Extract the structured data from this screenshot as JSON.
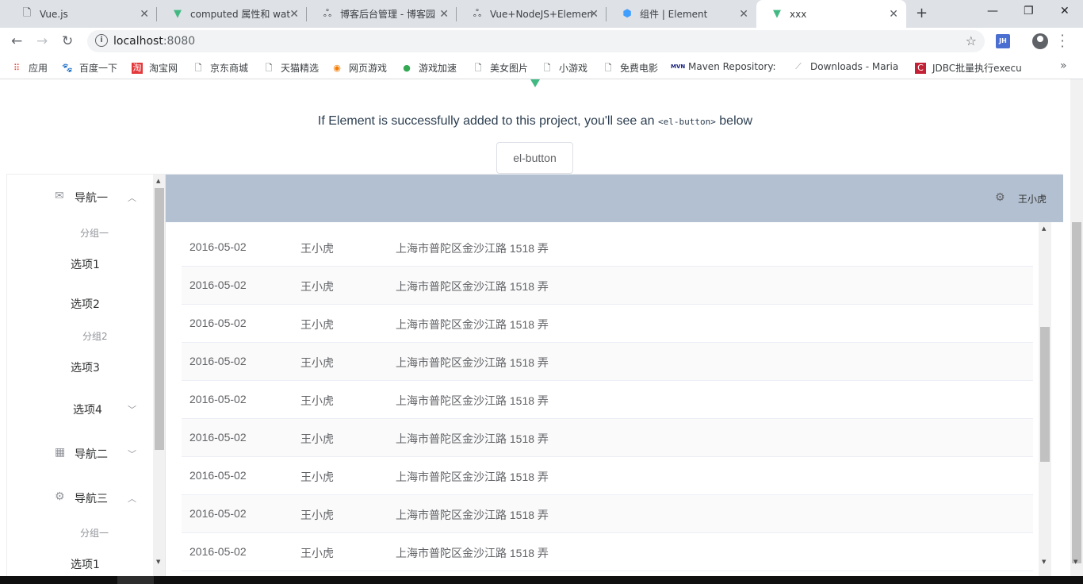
{
  "browser": {
    "tabs": [
      {
        "label": "Vue.js",
        "icon": "page-icon"
      },
      {
        "label": "computed 属性和 wat",
        "icon": "vue-icon"
      },
      {
        "label": "博客后台管理 - 博客园",
        "icon": "cnblogs-icon"
      },
      {
        "label": "Vue+NodeJS+Elemen",
        "icon": "cnblogs-icon"
      },
      {
        "label": "组件 | Element",
        "icon": "element-icon"
      },
      {
        "label": "xxx",
        "icon": "vue-icon"
      }
    ],
    "url_host": "localhost",
    "url_port": ":8080",
    "extension_label": "JH",
    "bookmarks": [
      "应用",
      "百度一下",
      "淘宝网",
      "京东商城",
      "天猫精选",
      "网页游戏",
      "游戏加速",
      "美女图片",
      "小游戏",
      "免费电影",
      "Maven Repository:",
      "Downloads - Maria",
      "JDBC批量执行execu"
    ]
  },
  "hello": {
    "before": "If Element is successfully added to this project, you'll see an",
    "code": "<el-button>",
    "after": "below"
  },
  "el_button_label": "el-button",
  "menu": {
    "nav1": "导航一",
    "group1": "分组一",
    "option1": "选项1",
    "option2": "选项2",
    "group2": "分组2",
    "option3": "选项3",
    "option4": "选项4",
    "nav2": "导航二",
    "nav3": "导航三",
    "nav3_group1": "分组一",
    "nav3_option1": "选项1"
  },
  "header": {
    "user_name": "王小虎"
  },
  "table": {
    "rows": [
      {
        "date": "2016-05-02",
        "name": "王小虎",
        "address": "上海市普陀区金沙江路 1518 弄"
      },
      {
        "date": "2016-05-02",
        "name": "王小虎",
        "address": "上海市普陀区金沙江路 1518 弄"
      },
      {
        "date": "2016-05-02",
        "name": "王小虎",
        "address": "上海市普陀区金沙江路 1518 弄"
      },
      {
        "date": "2016-05-02",
        "name": "王小虎",
        "address": "上海市普陀区金沙江路 1518 弄"
      },
      {
        "date": "2016-05-02",
        "name": "王小虎",
        "address": "上海市普陀区金沙江路 1518 弄"
      },
      {
        "date": "2016-05-02",
        "name": "王小虎",
        "address": "上海市普陀区金沙江路 1518 弄"
      },
      {
        "date": "2016-05-02",
        "name": "王小虎",
        "address": "上海市普陀区金沙江路 1518 弄"
      },
      {
        "date": "2016-05-02",
        "name": "王小虎",
        "address": "上海市普陀区金沙江路 1518 弄"
      },
      {
        "date": "2016-05-02",
        "name": "王小虎",
        "address": "上海市普陀区金沙江路 1518 弄"
      }
    ]
  },
  "colors": {
    "header_bg": "#b3c0d1",
    "vue_green": "#42b983"
  }
}
